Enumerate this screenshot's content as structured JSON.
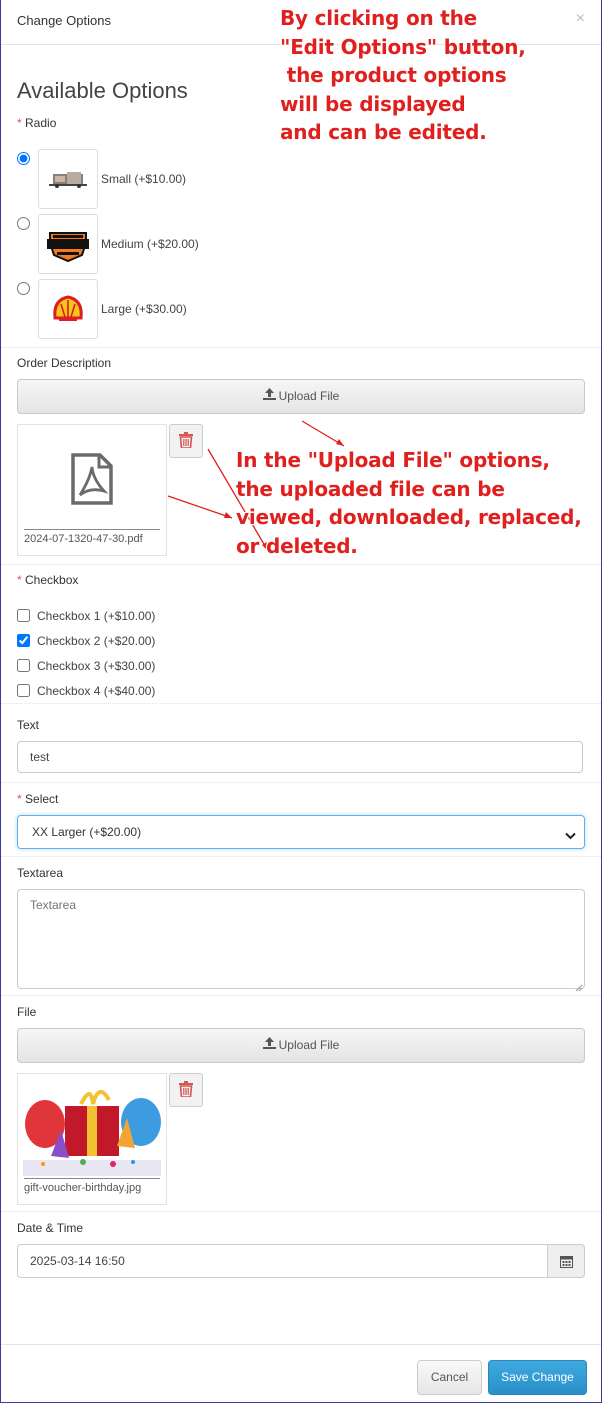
{
  "modal": {
    "title": "Change Options",
    "close_glyph": "×"
  },
  "heading": "Available Options",
  "radio": {
    "label": "Radio",
    "required_mark": "*",
    "options": [
      {
        "label": "Small (+$10.00)",
        "checked": true,
        "thumb": "truck-thumbnail"
      },
      {
        "label": "Medium (+$20.00)",
        "checked": false,
        "thumb": "harley-davidson-logo"
      },
      {
        "label": "Large (+$30.00)",
        "checked": false,
        "thumb": "shell-logo"
      }
    ]
  },
  "order_description": {
    "label": "Order Description",
    "upload_label": "Upload File",
    "file_name": "2024-07-1320-47-30.pdf",
    "file_icon": "pdf-icon"
  },
  "checkbox": {
    "label": "Checkbox",
    "required_mark": "*",
    "items": [
      {
        "label": "Checkbox 1 (+$10.00)",
        "checked": false
      },
      {
        "label": "Checkbox 2 (+$20.00)",
        "checked": true
      },
      {
        "label": "Checkbox 3 (+$30.00)",
        "checked": false
      },
      {
        "label": "Checkbox 4 (+$40.00)",
        "checked": false
      }
    ]
  },
  "text_field": {
    "label": "Text",
    "value": "test"
  },
  "select": {
    "label": "Select",
    "required_mark": "*",
    "value": "XX Larger (+$20.00)"
  },
  "textarea": {
    "label": "Textarea",
    "placeholder": "Textarea"
  },
  "file_field": {
    "label": "File",
    "upload_label": "Upload File",
    "file_name": "gift-voucher-birthday.jpg"
  },
  "datetime": {
    "label": "Date & Time",
    "value": "2025-03-14 16:50"
  },
  "buttons": {
    "cancel": "Cancel",
    "save": "Save Change"
  },
  "annotations": {
    "top": "By clicking on the\n\"Edit Options\" button,\n the product options\nwill be displayed\nand can be edited.",
    "middle": "In the \"Upload File\" options,\nthe uploaded file can be\nviewed, downloaded, replaced,\nor deleted."
  },
  "colors": {
    "annotation": "#e0201f",
    "primary_button": "#2a8fc8",
    "required": "#d9534f",
    "delete_icon": "#d9534f"
  }
}
